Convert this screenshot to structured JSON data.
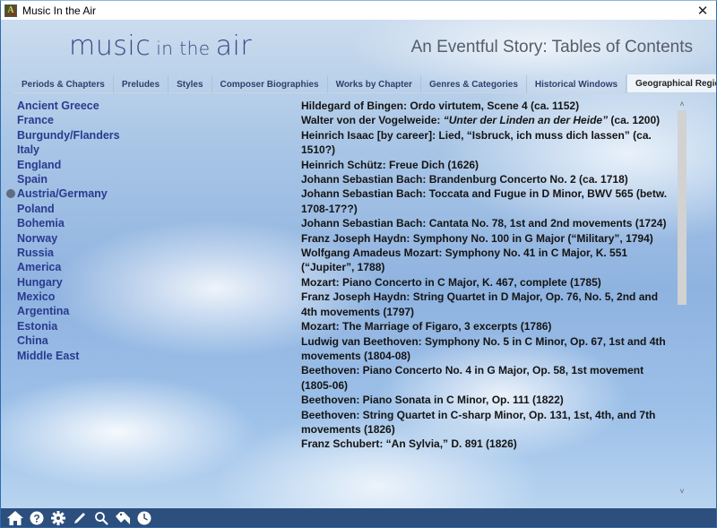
{
  "window": {
    "title": "Music In the Air",
    "close_glyph": "✕",
    "app_icon_letter": "A"
  },
  "header": {
    "logo": {
      "word1": "music",
      "word2": "in the",
      "word3": "air"
    },
    "title": "An Eventful Story: Tables of Contents"
  },
  "tabs": [
    {
      "label": "Periods & Chapters",
      "active": false
    },
    {
      "label": "Preludes",
      "active": false
    },
    {
      "label": "Styles",
      "active": false
    },
    {
      "label": "Composer Biographies",
      "active": false
    },
    {
      "label": "Works by Chapter",
      "active": false
    },
    {
      "label": "Genres & Categories",
      "active": false
    },
    {
      "label": "Historical Windows",
      "active": false
    },
    {
      "label": "Geographical Regions",
      "active": true
    }
  ],
  "regions": {
    "selected_index": 6,
    "items": [
      "Ancient Greece",
      "France",
      "Burgundy/Flanders",
      "Italy",
      "England",
      "Spain",
      "Austria/Germany",
      "Poland",
      "Bohemia",
      "Norway",
      "Russia",
      "America",
      "Hungary",
      "Mexico",
      "Argentina",
      "Estonia",
      "China",
      "Middle East"
    ]
  },
  "works": [
    {
      "pre": "Hildegard of Bingen: Ordo virtutem, Scene 4 (ca. 1152)"
    },
    {
      "pre": "Walter von der Vogelweide: ",
      "ital": "“Unter der Linden an der Heide”",
      "post": " (ca. 1200)"
    },
    {
      "pre": "Heinrich Isaac [by career]: Lied, “Isbruck, ich muss dich lassen” (ca. 1510?)"
    },
    {
      "pre": "Heinrich Schütz: Freue Dich (1626)"
    },
    {
      "pre": "Johann Sebastian Bach: Brandenburg Concerto No. 2 (ca. 1718)"
    },
    {
      "pre": "Johann Sebastian Bach: Toccata and Fugue in D Minor, BWV 565 (betw. 1708-17??)"
    },
    {
      "pre": "Johann Sebastian Bach: Cantata No. 78, 1st and 2nd movements (1724)"
    },
    {
      "pre": "Franz Joseph Haydn: Symphony No. 100 in G Major (“Military”, 1794)"
    },
    {
      "pre": "Wolfgang Amadeus Mozart: Symphony No. 41 in C Major, K. 551 (“Jupiter”, 1788)"
    },
    {
      "pre": "Mozart: Piano Concerto in C Major, K. 467, complete (1785)"
    },
    {
      "pre": "Franz Joseph Haydn: String Quartet in D Major, Op. 76, No. 5, 2nd and 4th movements (1797)"
    },
    {
      "pre": "Mozart: The Marriage of Figaro, 3 excerpts (1786)"
    },
    {
      "pre": "Ludwig van Beethoven: Symphony No. 5 in C Minor, Op. 67, 1st and 4th movements (1804-08)"
    },
    {
      "pre": "Beethoven: Piano Concerto No. 4 in G Major, Op. 58, 1st movement (1805-06)"
    },
    {
      "pre": "Beethoven: Piano Sonata in C Minor, Op. 111 (1822)"
    },
    {
      "pre": "Beethoven: String Quartet in C-sharp Minor, Op. 131, 1st, 4th, and 7th movements (1826)"
    },
    {
      "pre": "Franz Schubert: “An Sylvia,” D. 891  (1826)"
    }
  ],
  "scrollbar": {
    "up_glyph": "˄",
    "down_glyph": "˅",
    "position_fraction": 0.0,
    "visible_fraction": 0.52
  },
  "toolbar": {
    "icons": [
      "home-icon",
      "help-icon",
      "gear-icon",
      "pencil-icon",
      "search-icon",
      "bookmark-tag-icon",
      "clock-icon"
    ]
  }
}
